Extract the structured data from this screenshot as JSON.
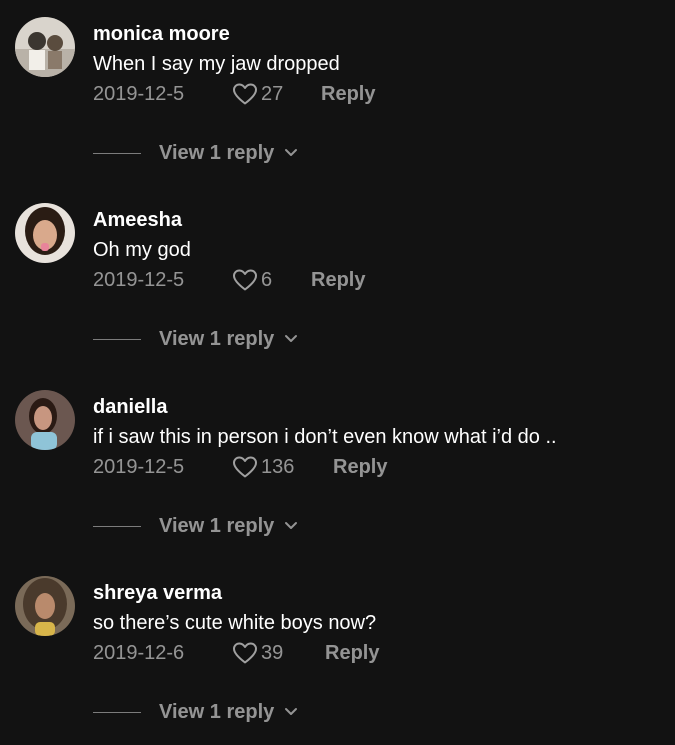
{
  "comments": [
    {
      "username": "monica moore",
      "text": "When I say my jaw dropped",
      "date": "2019-12-5",
      "likes": "27",
      "reply_label": "Reply",
      "view_replies_label": "View 1 reply",
      "avatar_colors": [
        "#d9d4cc",
        "#3b3630"
      ]
    },
    {
      "username": "Ameesha",
      "text": "Oh my god",
      "date": "2019-12-5",
      "likes": "6",
      "reply_label": "Reply",
      "view_replies_label": "View 1 reply",
      "avatar_colors": [
        "#e8e2dc",
        "#2a1c14"
      ]
    },
    {
      "username": "daniella",
      "text": "if i saw this in person i don’t even know what i’d do ..",
      "date": "2019-12-5",
      "likes": "136",
      "reply_label": "Reply",
      "view_replies_label": "View 1 reply",
      "avatar_colors": [
        "#6b5750",
        "#8fc4d8"
      ]
    },
    {
      "username": "shreya verma",
      "text": "so there’s cute white boys now?",
      "date": "2019-12-6",
      "likes": "39",
      "reply_label": "Reply",
      "view_replies_label": "View 1 reply",
      "avatar_colors": [
        "#4a3a2c",
        "#d8b54a"
      ]
    }
  ],
  "icons": {
    "like": "heart-outline-icon",
    "expand": "chevron-down-icon"
  }
}
